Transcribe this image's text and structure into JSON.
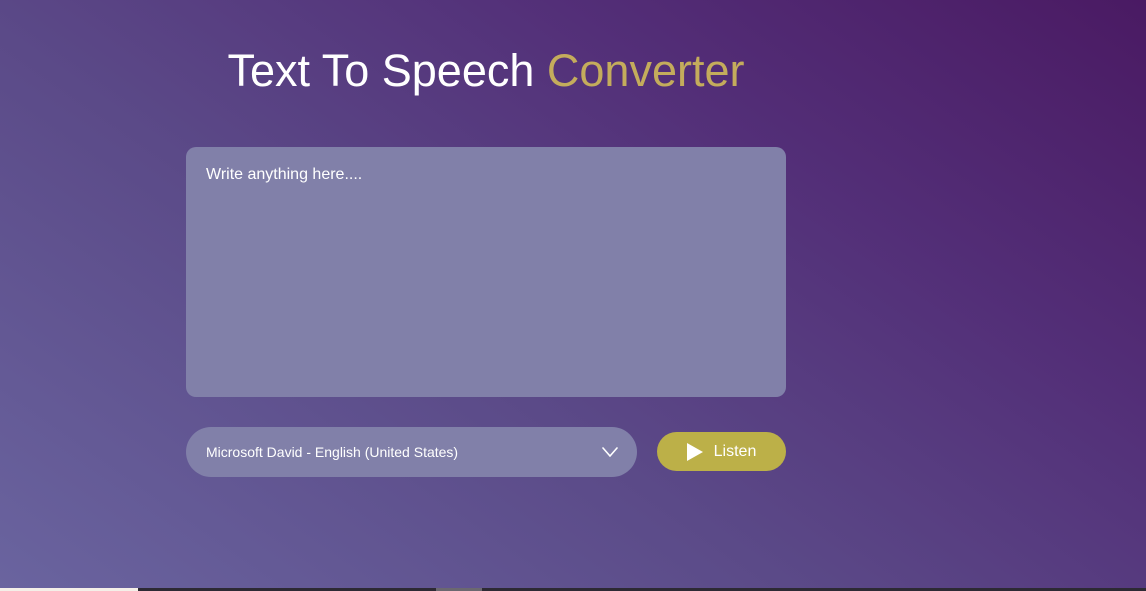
{
  "header": {
    "title_main": "Text To Speech",
    "title_accent": "Converter"
  },
  "editor": {
    "placeholder": "Write anything here....",
    "value": ""
  },
  "voice_select": {
    "selected": "Microsoft David - English (United States)",
    "icon": "chevron-down-icon"
  },
  "listen_button": {
    "label": "Listen",
    "icon": "play-icon"
  },
  "colors": {
    "accent": "#c4ac5c",
    "panel": "#8180a9",
    "button": "#bcb048",
    "background_start": "#6a649f",
    "background_end": "#4a1a63"
  }
}
